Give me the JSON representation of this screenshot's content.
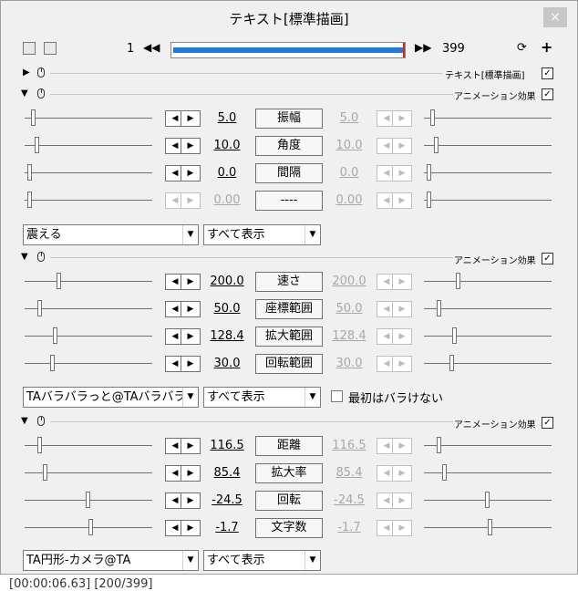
{
  "window": {
    "title": "テキスト[標準描画]",
    "close_label": "×"
  },
  "timeline": {
    "start_frame": "1",
    "end_frame": "399",
    "prev_label": "◀◀",
    "next_label": "▶▶",
    "loop_icon": "loop-icon",
    "add_label": "+"
  },
  "header_rows": [
    {
      "label": "テキスト[標準描画]",
      "checked": true
    },
    {
      "label": "アニメーション効果",
      "checked": true
    }
  ],
  "section1": {
    "label": "アニメーション効果",
    "params": [
      {
        "name": "振幅",
        "left": "5.0",
        "right": "5.0",
        "left_thumb": 0.05,
        "right_thumb": 0.05
      },
      {
        "name": "角度",
        "left": "10.0",
        "right": "10.0",
        "left_thumb": 0.08,
        "right_thumb": 0.08
      },
      {
        "name": "間隔",
        "left": "0.0",
        "right": "0.0",
        "left_thumb": 0.02,
        "right_thumb": 0.02
      },
      {
        "name": "----",
        "left": "0.00",
        "right": "0.00",
        "left_thumb": 0.02,
        "right_thumb": 0.02,
        "disabled": true
      }
    ],
    "effect_select": "震える",
    "display_select": "すべて表示"
  },
  "section2": {
    "label": "アニメーション効果",
    "params": [
      {
        "name": "速さ",
        "left": "200.0",
        "right": "200.0",
        "left_thumb": 0.25,
        "right_thumb": 0.25
      },
      {
        "name": "座標範囲",
        "left": "50.0",
        "right": "50.0",
        "left_thumb": 0.1,
        "right_thumb": 0.1
      },
      {
        "name": "拡大範囲",
        "left": "128.4",
        "right": "128.4",
        "left_thumb": 0.22,
        "right_thumb": 0.22
      },
      {
        "name": "回転範囲",
        "left": "30.0",
        "right": "30.0",
        "left_thumb": 0.2,
        "right_thumb": 0.2
      }
    ],
    "effect_select": "TAバラバラっと@TAバラバラっ",
    "display_select": "すべて表示",
    "option_label": "最初はバラけない",
    "option_checked": false
  },
  "section3": {
    "label": "アニメーション効果",
    "params": [
      {
        "name": "距離",
        "left": "116.5",
        "right": "116.5",
        "left_thumb": 0.1,
        "right_thumb": 0.1
      },
      {
        "name": "拡大率",
        "left": "85.4",
        "right": "85.4",
        "left_thumb": 0.14,
        "right_thumb": 0.14
      },
      {
        "name": "回転",
        "left": "-24.5",
        "right": "-24.5",
        "left_thumb": 0.48,
        "right_thumb": 0.48
      },
      {
        "name": "文字数",
        "left": "-1.7",
        "right": "-1.7",
        "left_thumb": 0.5,
        "right_thumb": 0.5
      }
    ],
    "effect_select": "TA円形-カメラ@TA",
    "display_select": "すべて表示"
  },
  "status_bar": "[00:00:06.63] [200/399]"
}
